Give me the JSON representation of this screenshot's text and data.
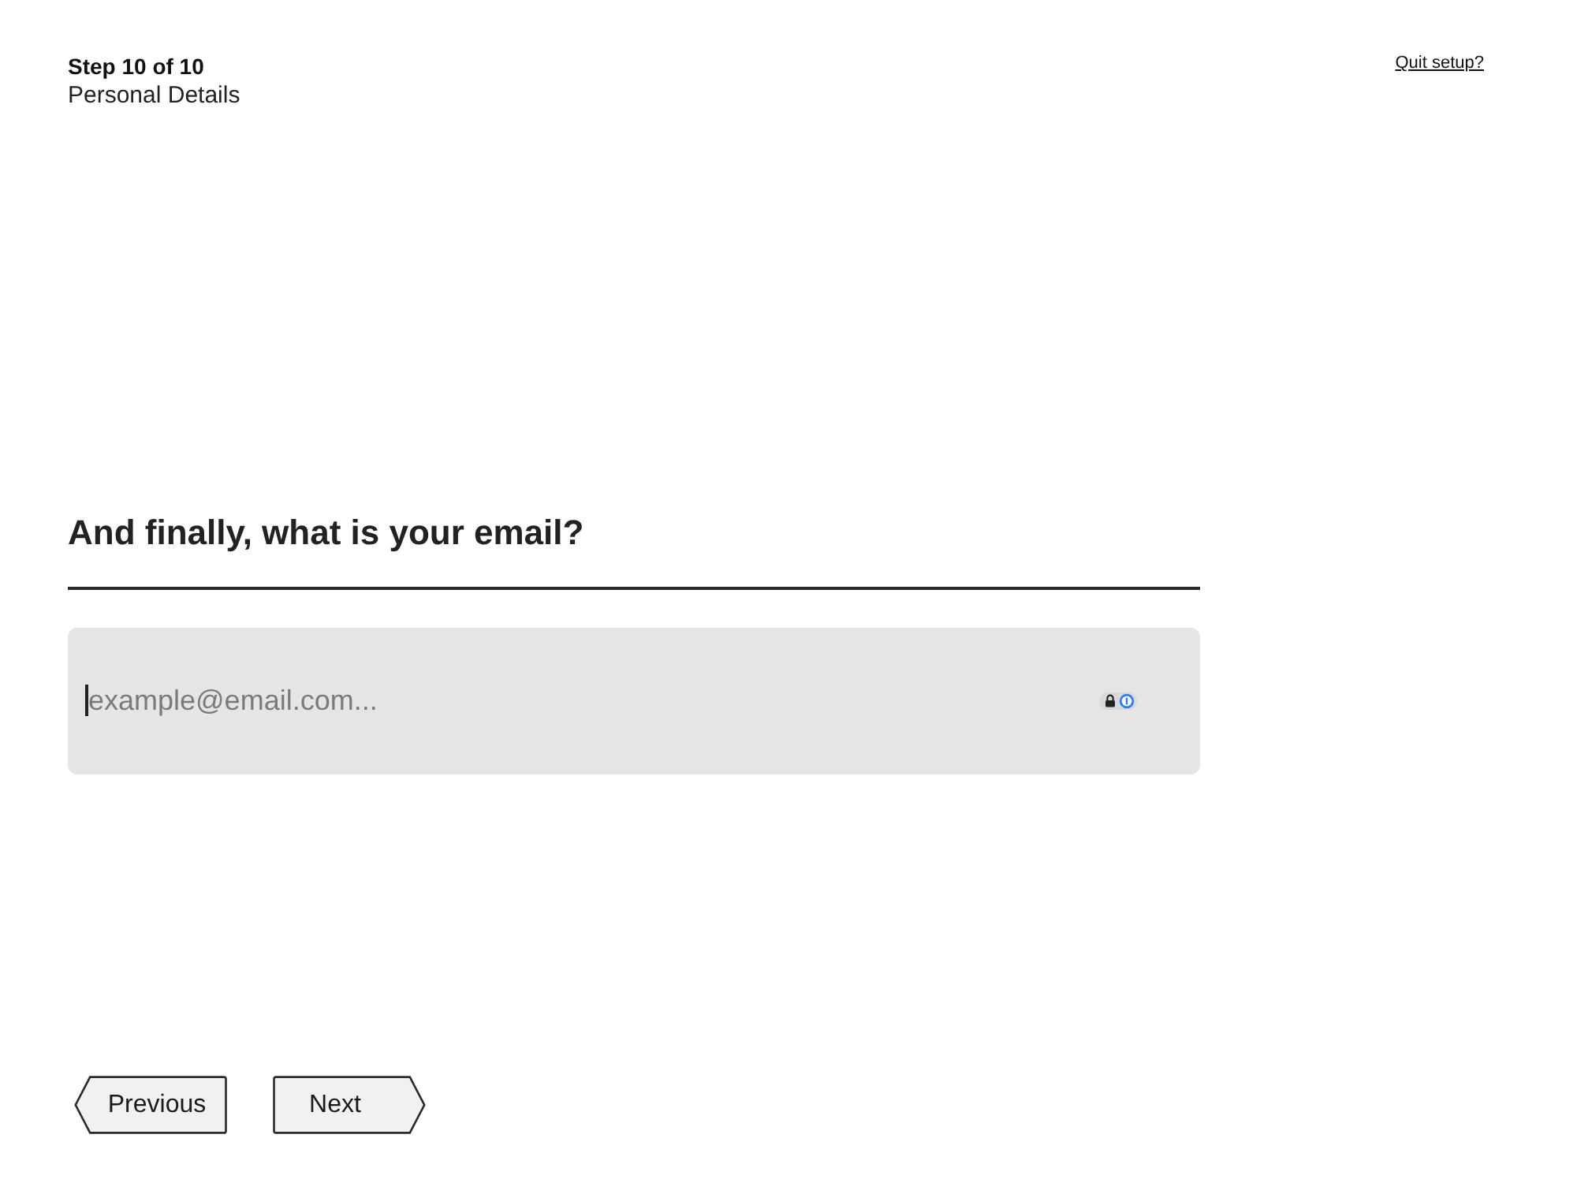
{
  "header": {
    "step": "Step 10 of 10",
    "section": "Personal Details",
    "quit_link": "Quit setup?"
  },
  "question": {
    "title": "And finally, what is your email?"
  },
  "email_field": {
    "placeholder": "example@email.com...",
    "focused": true
  },
  "buttons": [
    {
      "label": "Previous",
      "kind": "back"
    },
    {
      "label": "Next",
      "kind": "forward"
    }
  ]
}
